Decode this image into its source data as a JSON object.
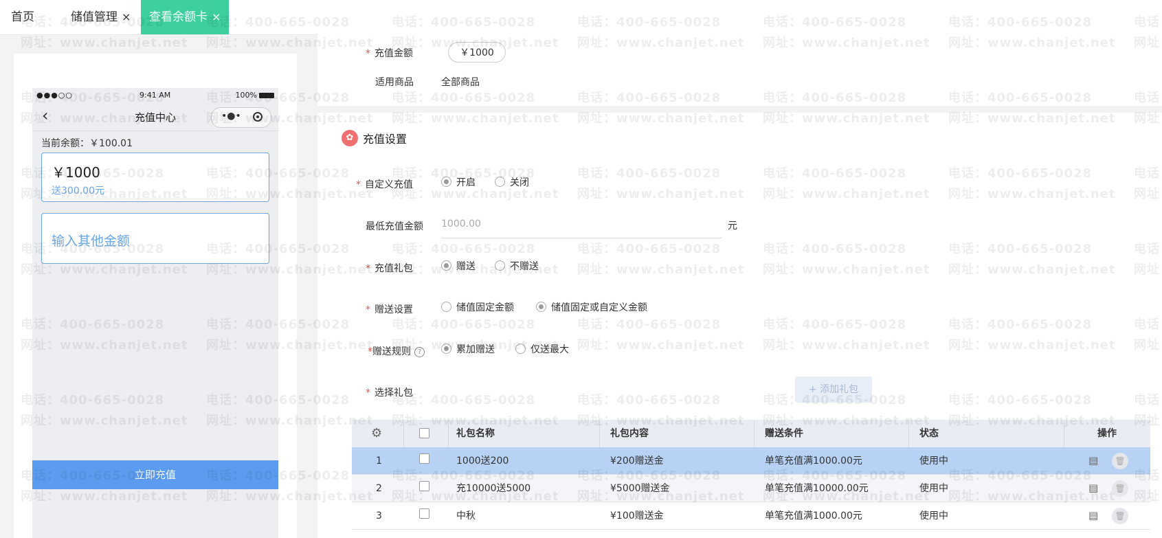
{
  "tabs": [
    {
      "label": "首页"
    },
    {
      "label": "储值管理",
      "close": "×"
    },
    {
      "label": "查看余额卡",
      "close": "×"
    }
  ],
  "phone": {
    "status_signal": "●●●○○",
    "status_time": "9:41 AM",
    "status_battery": "100%",
    "nav_title": "充值中心",
    "balance": "当前余额：￥100.01",
    "card_amount": "￥1000",
    "card_gift": "送300.00元",
    "custom_placeholder": "输入其他金额",
    "pay_button": "立即充值"
  },
  "form": {
    "recharge_amount_label": "充值金额",
    "recharge_amount_value": "￥1000",
    "goods_label": "适用商品",
    "goods_value": "全部商品",
    "section_title": "充值设置",
    "custom_label": "自定义充值",
    "custom_opt_on": "开启",
    "custom_opt_off": "关闭",
    "min_label": "最低充值金额",
    "min_placeholder": "1000.00",
    "min_unit": "元",
    "gift_label": "充值礼包",
    "gift_opt_give": "赠送",
    "gift_opt_nogive": "不赠送",
    "give_label": "赠送设置",
    "give_opt_fixed": "储值固定金额",
    "give_opt_fixed_custom": "储值固定或自定义金额",
    "rule_label": "赠送规则",
    "rule_opt_sum": "累加赠送",
    "rule_opt_max": "仅送最大",
    "select_label": "选择礼包",
    "add_button": "+ 添加礼包"
  },
  "table": {
    "headers": [
      "礼包名称",
      "礼包内容",
      "赠送条件",
      "状态",
      "操作"
    ],
    "rows": [
      {
        "idx": "1",
        "name": "1000送200",
        "content": "¥200赠送金",
        "cond": "单笔充值满1000.00元",
        "status": "使用中"
      },
      {
        "idx": "2",
        "name": "充10000送5000",
        "content": "¥5000赠送金",
        "cond": "单笔充值满10000.00元",
        "status": "使用中"
      },
      {
        "idx": "3",
        "name": "中秋",
        "content": "¥100赠送金",
        "cond": "单笔充值满1000.00元",
        "status": "使用中"
      }
    ]
  },
  "watermark": {
    "phone": "电话：400-665-0028",
    "site": "网址：www.chanjet.net"
  },
  "colors": {
    "active_tab": "#3ecf9e",
    "link_blue": "#6aa6e8",
    "pay_button": "#5b9cf0",
    "selected_row": "#b7d2f5",
    "required": "#e5534b"
  }
}
